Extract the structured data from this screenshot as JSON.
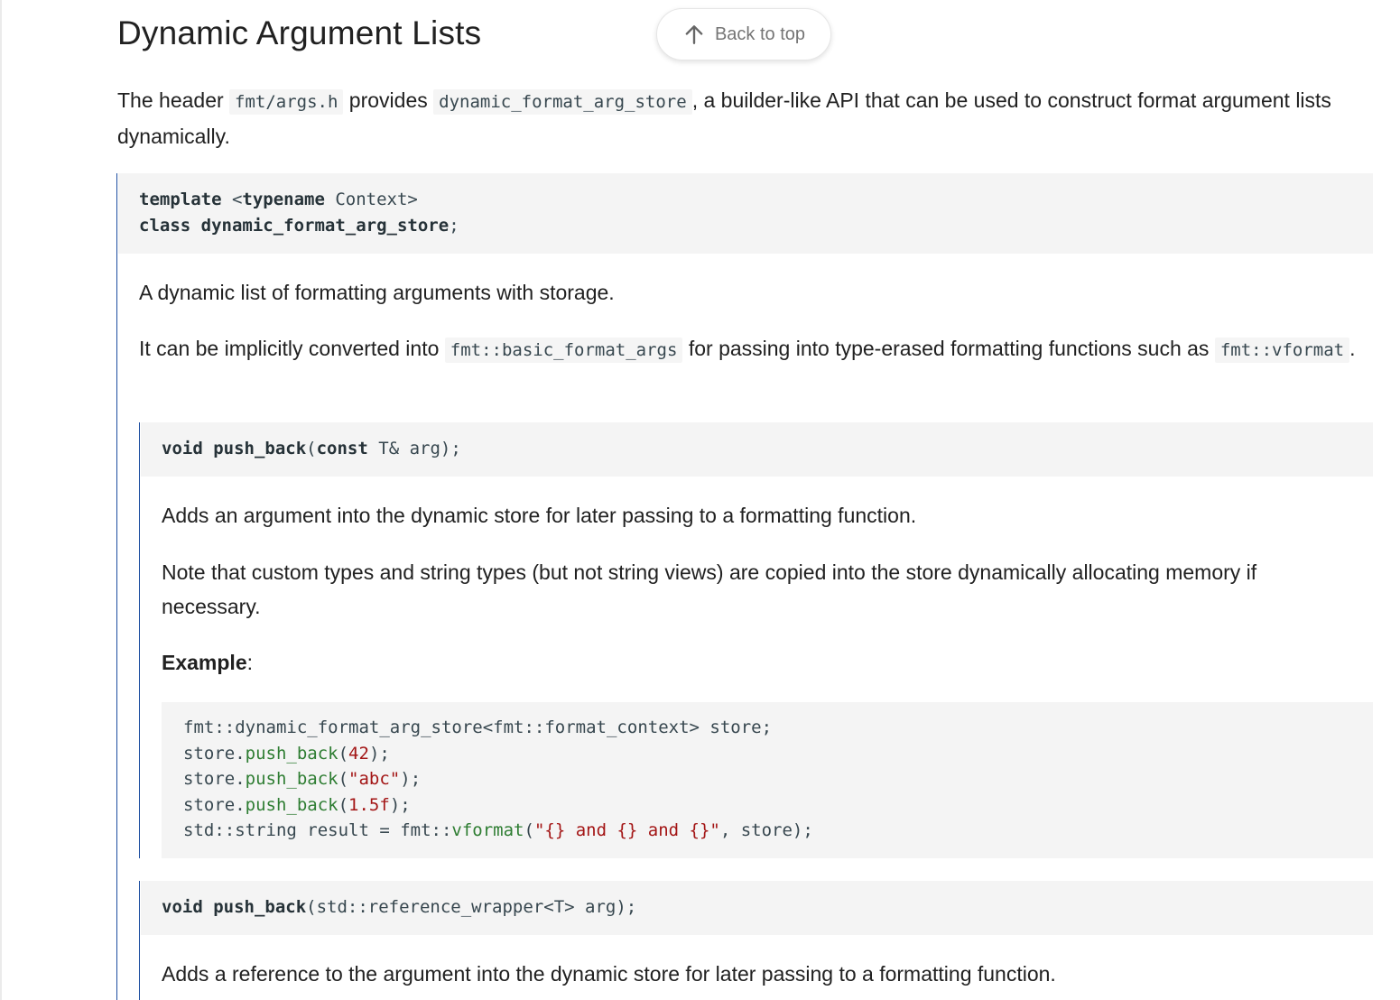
{
  "header": {
    "title": "Dynamic Argument Lists",
    "back_to_top_label": "Back to top"
  },
  "intro": {
    "text_1": "The header ",
    "code_1": "fmt/args.h",
    "text_2": " provides ",
    "code_2": "dynamic_format_arg_store",
    "text_3": ", a builder-like API that can be used to construct format argument lists dynamically."
  },
  "class_decl": {
    "line1_kw": "template",
    "line1_a": " <",
    "line1_kw2": "typename",
    "line1_b": " Context>",
    "line2_kw": "class",
    "line2_name": " dynamic_format_arg_store",
    "line2_end": ";",
    "desc": "A dynamic list of formatting arguments with storage.",
    "note_1": "It can be implicitly converted into ",
    "note_code_1": "fmt::basic_format_args",
    "note_2": " for passing into type-erased formatting functions such as ",
    "note_code_2": "fmt::vformat",
    "note_3": "."
  },
  "push_back_1": {
    "sig_kw": "void",
    "sig_name": " push_back",
    "sig_open": "(",
    "sig_kw2": "const",
    "sig_rest": " T& arg);",
    "desc": "Adds an argument into the dynamic store for later passing to a formatting function.",
    "note": "Note that custom types and string types (but not string views) are copied into the store dynamically allocating memory if necessary.",
    "example_label": "Example",
    "example_colon": ":",
    "code": {
      "l1": "fmt::dynamic_format_arg_store<fmt::format_context> store;",
      "l2_a": "store.",
      "l2_fn": "push_back",
      "l2_b": "(",
      "l2_v": "42",
      "l2_c": ");",
      "l3_a": "store.",
      "l3_fn": "push_back",
      "l3_b": "(",
      "l3_v": "\"abc\"",
      "l3_c": ");",
      "l4_a": "store.",
      "l4_fn": "push_back",
      "l4_b": "(",
      "l4_v": "1.5f",
      "l4_c": ");",
      "l5_a": "std::string result = fmt::",
      "l5_fn": "vformat",
      "l5_b": "(",
      "l5_v": "\"{} and {} and {}\"",
      "l5_c": ", store);"
    }
  },
  "push_back_2": {
    "sig_kw": "void",
    "sig_name": " push_back",
    "sig_rest": "(std::reference_wrapper<T> arg);",
    "desc": "Adds a reference to the argument into the dynamic store for later passing to a formatting function."
  },
  "colors": {
    "accent_border": "#1e4fa1",
    "code_bg": "#f4f4f4",
    "function_green": "#2e7d32",
    "literal_red": "#a31515"
  }
}
